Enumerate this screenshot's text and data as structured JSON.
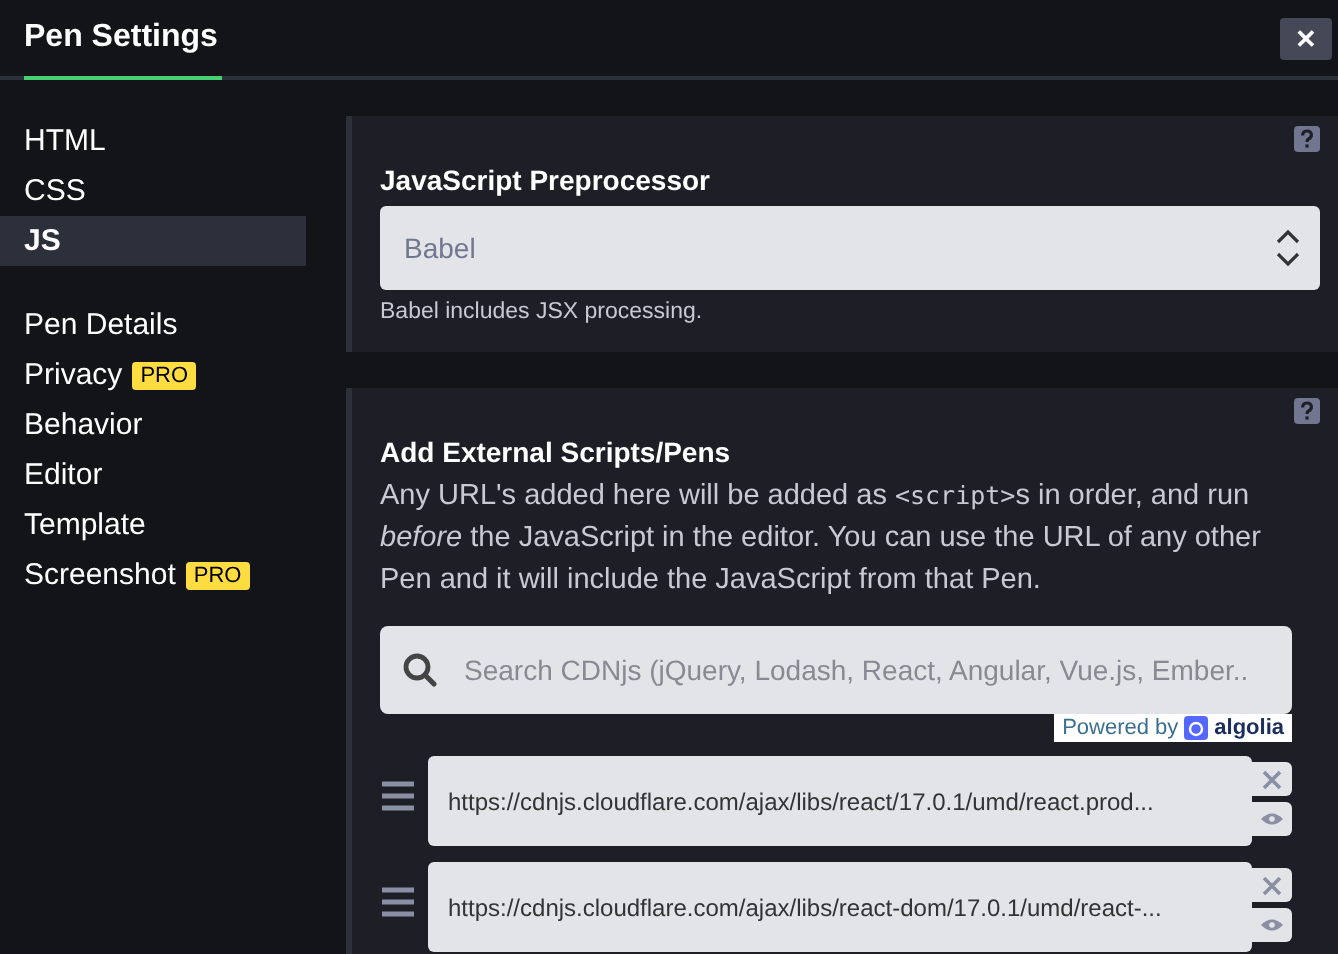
{
  "window": {
    "title": "Pen Settings",
    "close": "✕"
  },
  "sidebar": {
    "groups": [
      {
        "items": [
          {
            "label": "HTML",
            "selected": false
          },
          {
            "label": "CSS",
            "selected": false
          },
          {
            "label": "JS",
            "selected": true
          }
        ]
      },
      {
        "items": [
          {
            "label": "Pen Details",
            "selected": false
          },
          {
            "label": "Privacy",
            "badge": "PRO",
            "selected": false
          },
          {
            "label": "Behavior",
            "selected": false
          },
          {
            "label": "Editor",
            "selected": false
          },
          {
            "label": "Template",
            "selected": false
          },
          {
            "label": "Screenshot",
            "badge": "PRO",
            "selected": false
          }
        ]
      }
    ]
  },
  "preprocessor": {
    "title": "JavaScript Preprocessor",
    "value": "Babel",
    "help": "Babel includes JSX processing."
  },
  "external_scripts": {
    "title": "Add External Scripts/Pens",
    "description": [
      {
        "kind": "text",
        "text": "Any URL's added here will be added as "
      },
      {
        "kind": "code",
        "text": "<script>"
      },
      {
        "kind": "text",
        "text": "s in order, and run *before* the JavaScript in the editor. You can use the URL of any other Pen and it will include the JavaScript from that Pen."
      }
    ],
    "search": {
      "placeholder": "Search CDNjs (jQuery, Lodash, React, Angular, Vue.js, Ember.."
    },
    "powered_by": "Powered by",
    "provider": "algolia",
    "scripts": [
      {
        "url": "https://cdnjs.cloudflare.com/ajax/libs/react/17.0.1/umd/react.prod..."
      },
      {
        "url": "https://cdnjs.cloudflare.com/ajax/libs/react-dom/17.0.1/umd/react-..."
      }
    ]
  }
}
